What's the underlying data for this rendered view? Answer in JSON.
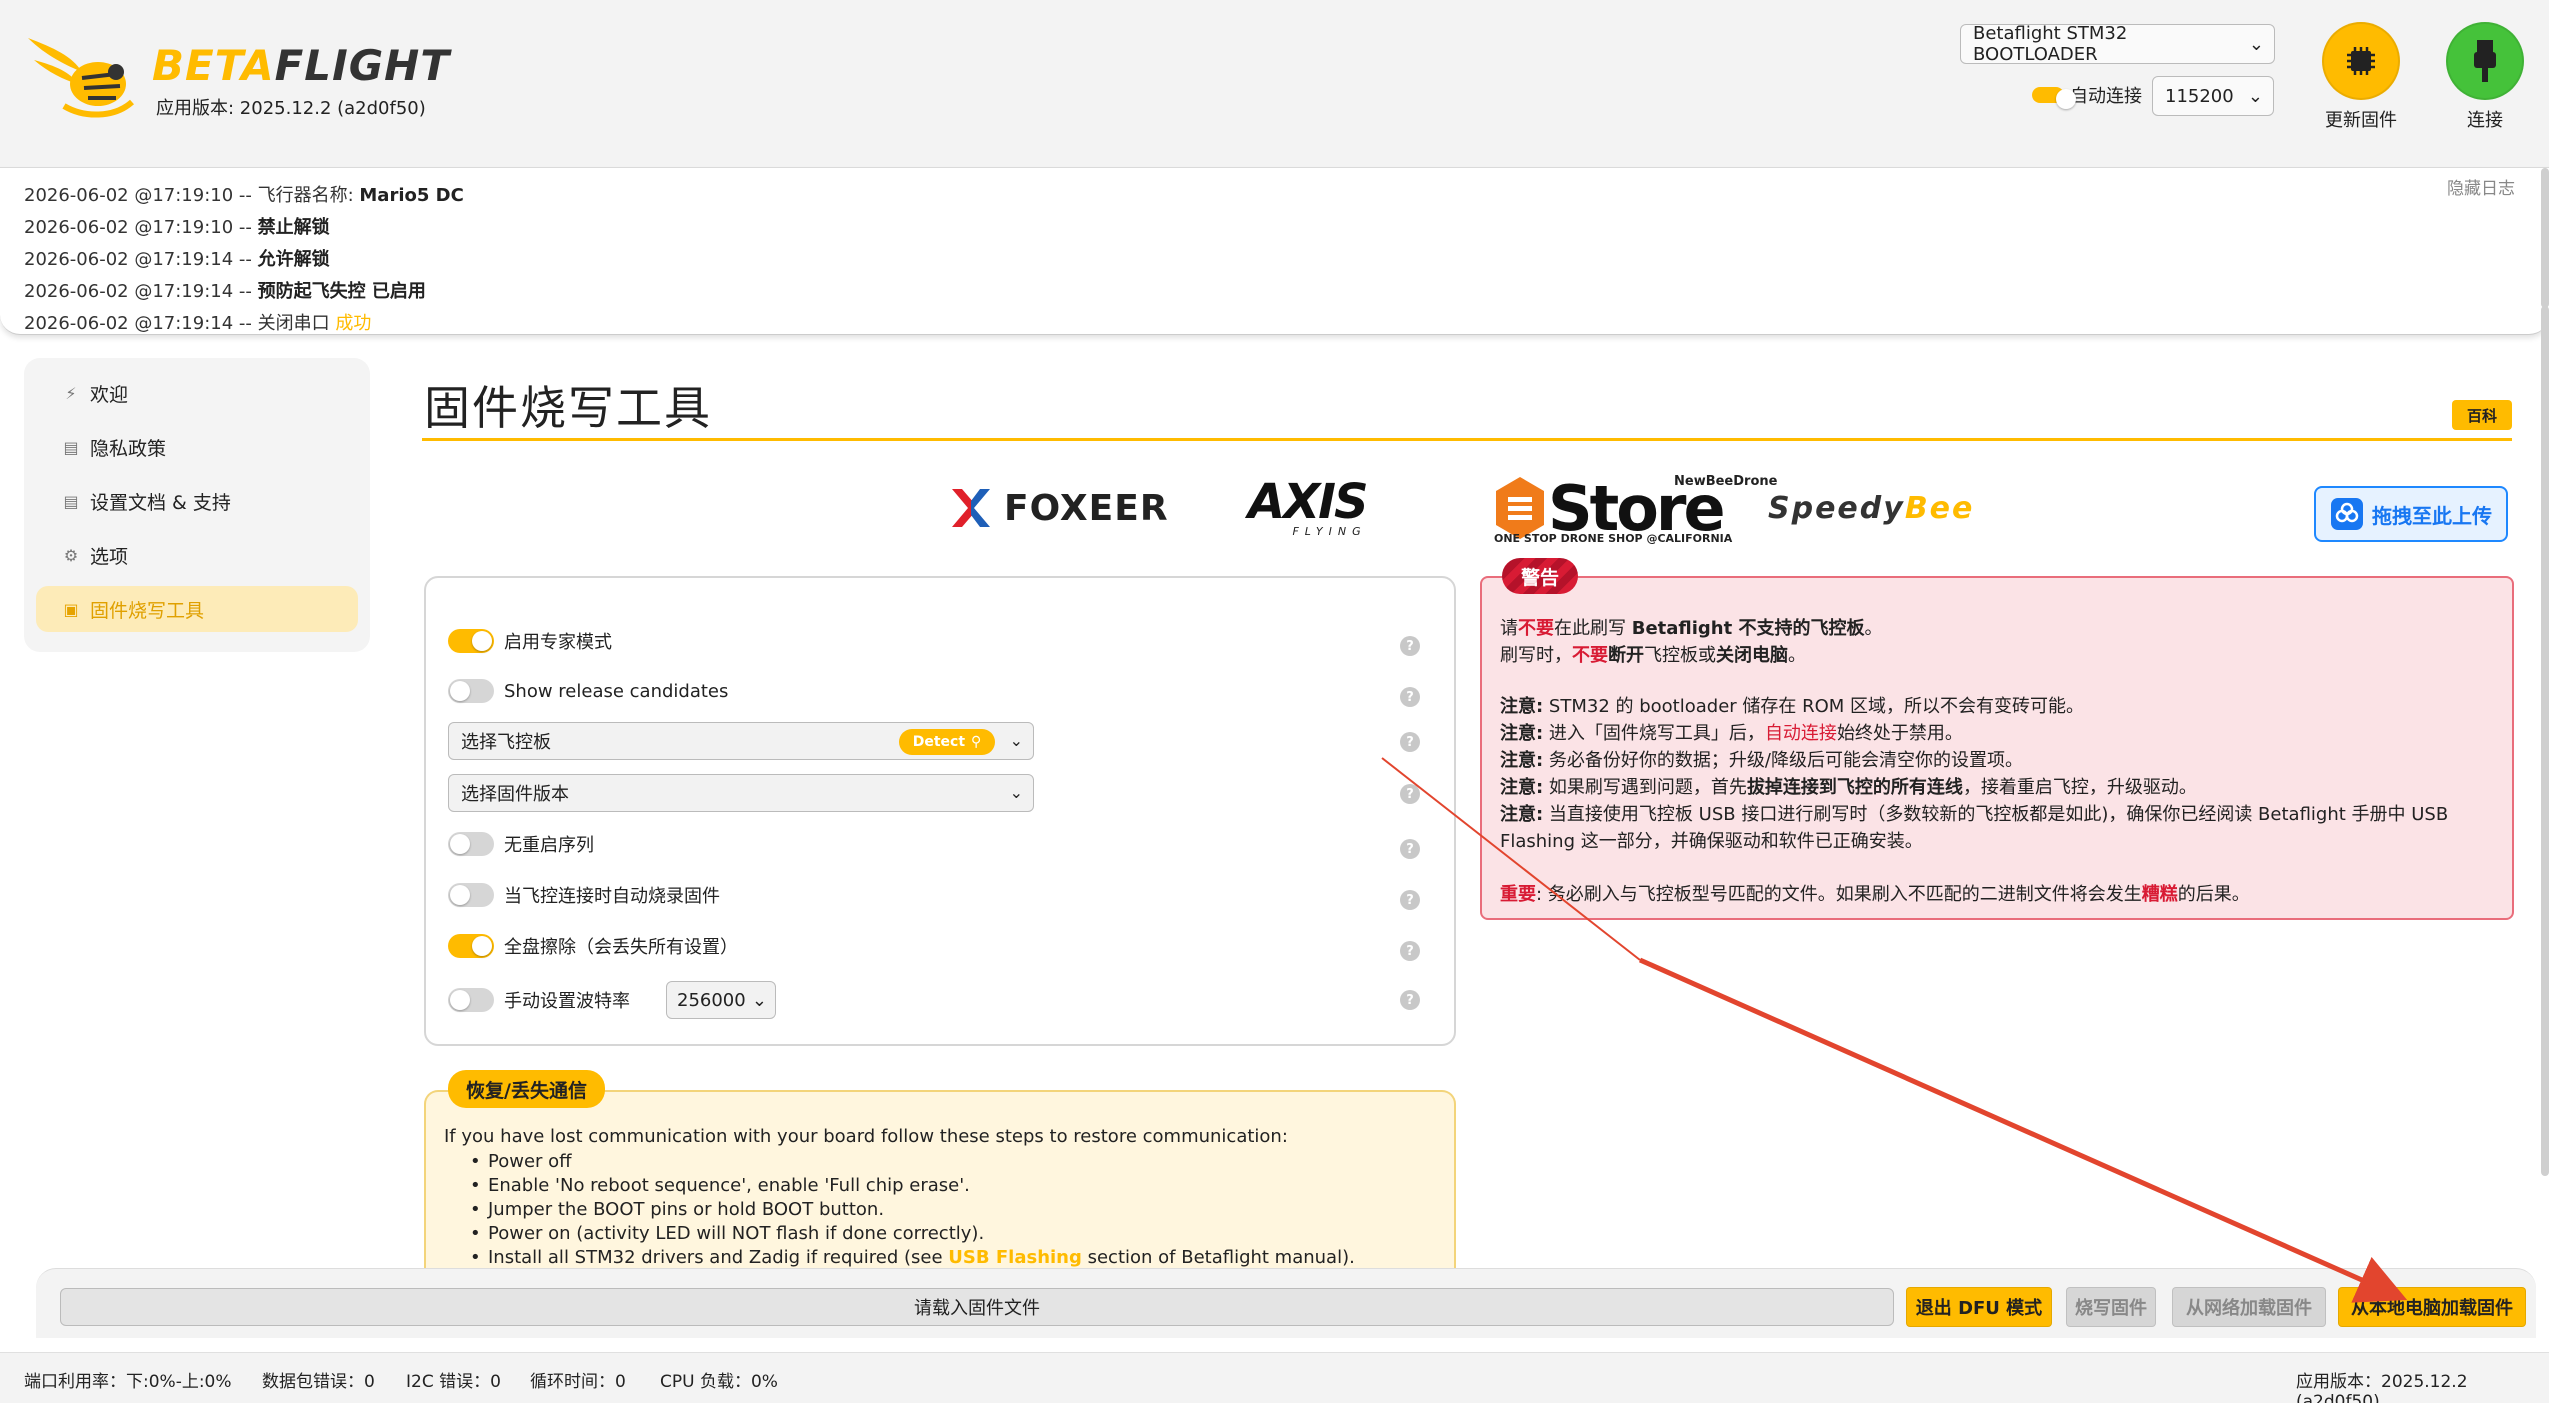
{
  "header": {
    "logo_part1": "BETA",
    "logo_part2": "FLIGHT",
    "app_version": "应用版本: 2025.12.2 (a2d0f50)",
    "port_select": "Betaflight STM32 BOOTLOADER",
    "auto_connect_label": "自动连接",
    "auto_connect_on": true,
    "baud_rate": "115200",
    "update_fw_label": "更新固件",
    "connect_label": "连接"
  },
  "log": {
    "hide_label": "隐藏日志",
    "lines": [
      {
        "prefix": "2026-06-02 @17:19:10 -- 飞行器名称: ",
        "bold": "Mario5 DC",
        "suffix": ""
      },
      {
        "prefix": "2026-06-02 @17:19:10 -- ",
        "bold": "禁止解锁",
        "suffix": ""
      },
      {
        "prefix": "2026-06-02 @17:19:14 -- ",
        "bold": "允许解锁",
        "suffix": ""
      },
      {
        "prefix": "2026-06-02 @17:19:14 -- ",
        "bold": "预防起飞失控 已启用",
        "suffix": ""
      },
      {
        "prefix": "2026-06-02 @17:19:14 -- 关闭串口 ",
        "bold": "",
        "suffix": "成功"
      }
    ]
  },
  "sidebar": {
    "items": [
      {
        "label": "欢迎",
        "icon": "plug-icon"
      },
      {
        "label": "隐私政策",
        "icon": "document-icon"
      },
      {
        "label": "设置文档 & 支持",
        "icon": "document-icon"
      },
      {
        "label": "选项",
        "icon": "gear-icon"
      },
      {
        "label": "固件烧写工具",
        "icon": "chip-icon"
      }
    ]
  },
  "main": {
    "title": "固件烧写工具",
    "wiki_label": "百科",
    "sponsors": [
      "FOXEER",
      "AXIS",
      "FLYING",
      "Store",
      "NewBeeDrone",
      "ONE STOP DRONE SHOP @CALIFORNIA",
      "Speedy",
      "Bee"
    ],
    "upload_label": "拖拽至此上传"
  },
  "options": {
    "expert_mode": "启用专家模式",
    "release_candidates": "Show release candidates",
    "select_board": "选择飞控板",
    "detect_label": "Detect",
    "select_version": "选择固件版本",
    "no_reboot": "无重启序列",
    "auto_flash": "当飞控连接时自动烧录固件",
    "full_erase": "全盘擦除（会丢失所有设置）",
    "manual_baud": "手动设置波特率",
    "manual_baud_value": "256000",
    "help_glyph": "?"
  },
  "warning": {
    "tag": "警告",
    "l1_a": "请",
    "l1_b": "不要",
    "l1_c": "在此刷写 ",
    "l1_d": "Betaflight 不支持的飞控板",
    "l1_e": "。",
    "l2_a": "刷写时，",
    "l2_b": "不要",
    "l2_c": "断开",
    "l2_d": "飞控板或",
    "l2_e": "关闭电脑",
    "l2_f": "。",
    "note_label": "注意:",
    "n1": " STM32 的 bootloader 储存在 ROM 区域，所以不会有变砖可能。",
    "n2_a": " 进入「固件烧写工具」后，",
    "n2_b": "自动连接",
    "n2_c": "始终处于禁用。",
    "n3": " 务必备份好你的数据；升级/降级后可能会清空你的设置项。",
    "n4_a": " 如果刷写遇到问题，首先",
    "n4_b": "拔掉连接到飞控的所有连线",
    "n4_c": "，接着重启飞控，升级驱动。",
    "n5": " 当直接使用飞控板 USB 接口进行刷写时（多数较新的飞控板都是如此)，确保你已经阅读 Betaflight 手册中 USB",
    "n5b": "Flashing 这一部分，并确保驱动和软件已正确安装。",
    "imp_label": "重要",
    "imp_a": ": 务必刷入与飞控板型号匹配的文件。如果刷入不匹配的二进制文件将会发生",
    "imp_b": "糟糕",
    "imp_c": "的后果。"
  },
  "recovery": {
    "tag": "恢复/丢失通信",
    "intro": "If you have lost communication with your board follow these steps to restore communication:",
    "items": [
      "Power off",
      "Enable 'No reboot sequence', enable 'Full chip erase'.",
      "Jumper the BOOT pins or hold BOOT button.",
      "Power on (activity LED will NOT flash if done correctly)."
    ],
    "last_a": "Install all STM32 drivers and Zadig if required (see ",
    "last_link": "USB Flashing",
    "last_b": " section of Betaflight manual)."
  },
  "actions": {
    "load_field": "请载入固件文件",
    "exit_dfu": "退出 DFU 模式",
    "flash_fw": "烧写固件",
    "load_online": "从网络加载固件",
    "load_local": "从本地电脑加载固件"
  },
  "status": {
    "port_util": "端口利用率：下:0%-上:0%",
    "packet_err": "数据包错误：0",
    "i2c_err": "I2C 错误：0",
    "cycle_time": "循环时间：0",
    "cpu_load": "CPU 负载：0%",
    "app_version": "应用版本：2025.12.2 (a2d0f50)"
  },
  "colors": {
    "accent": "#ffbb00",
    "connect": "#45c23a",
    "warning_red": "#d81b34",
    "annotation_arrow": "#e2452e"
  }
}
